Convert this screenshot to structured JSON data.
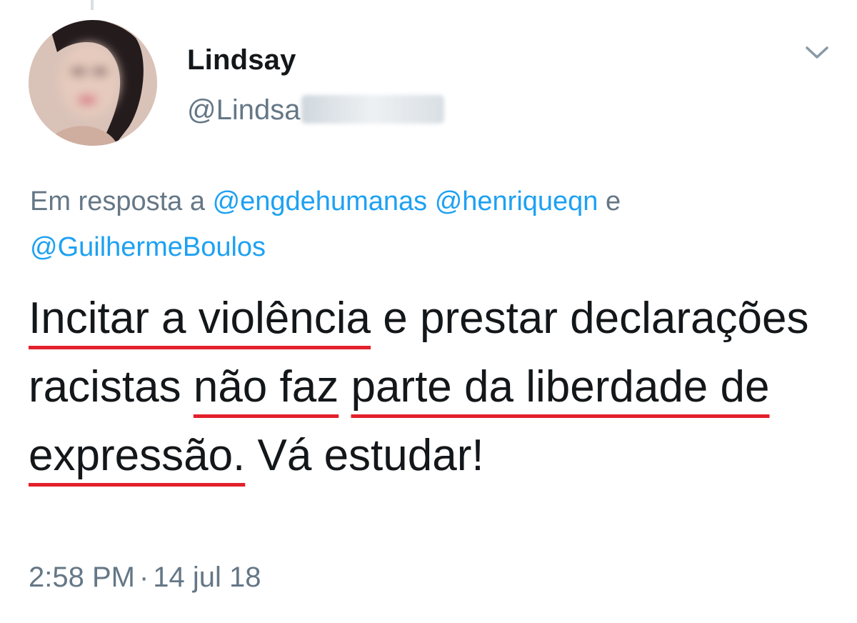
{
  "tweet": {
    "author": {
      "display_name": "Lindsay",
      "handle_visible": "@Lindsa",
      "avatar_icon": "blurred-profile-photo"
    },
    "more_menu_icon": "chevron-down-icon",
    "reply_context": {
      "prefix": "Em resposta a",
      "mentions": [
        "@engdehumanas",
        "@henriqueqn"
      ],
      "conjunction": "e",
      "last_mention": "@GuilhermeBoulos"
    },
    "text_segments": [
      {
        "text": "Incitar a violência",
        "underlined": true
      },
      {
        "text": " e prestar declarações racistas ",
        "underlined": false
      },
      {
        "text": "não faz",
        "underlined": true
      },
      {
        "text": " ",
        "underlined": false
      },
      {
        "text": "parte da liberdade de expressão.",
        "underlined": true
      },
      {
        "text": " Vá estudar!",
        "underlined": false
      }
    ],
    "time": "2:58 PM",
    "separator": "·",
    "date": "14 jul 18"
  },
  "colors": {
    "text_primary": "#14171a",
    "text_secondary": "#657786",
    "link": "#1da1f2",
    "highlight_underline": "#e3202b"
  }
}
